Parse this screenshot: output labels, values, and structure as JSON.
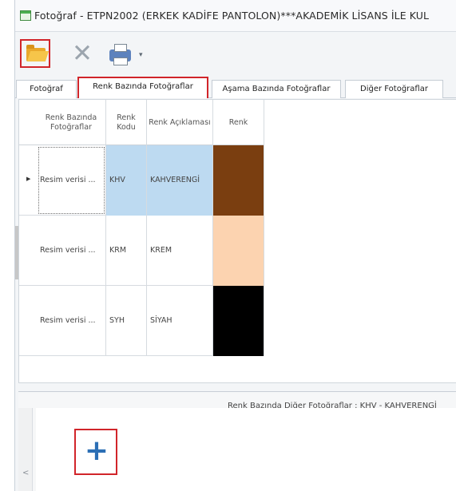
{
  "window": {
    "title": "Fotoğraf - ETPN2002 (ERKEK KADİFE PANTOLON)***AKADEMİK LİSANS İLE KUL"
  },
  "toolbar": {
    "open_icon": "folder-open-icon",
    "delete_icon": "delete-x-icon",
    "print_icon": "printer-icon",
    "print_dropdown_icon": "chevron-down-icon"
  },
  "tabs": [
    {
      "label": "Fotoğraf",
      "active": false
    },
    {
      "label": "Renk Bazında Fotoğraflar",
      "active": true
    },
    {
      "label": "Aşama Bazında Fotoğraflar",
      "active": false
    },
    {
      "label": "Diğer Fotoğraflar",
      "active": false
    }
  ],
  "grid": {
    "columns": [
      "Renk Bazında Fotoğraflar",
      "Renk Kodu",
      "Renk Açıklaması",
      "Renk"
    ],
    "rows": [
      {
        "photo": "Resim verisi ...",
        "code": "KHV",
        "description": "KAHVERENGİ",
        "color": "#7a3e10",
        "selected": true
      },
      {
        "photo": "Resim verisi ...",
        "code": "KRM",
        "description": "KREM",
        "color": "#fcd3b0",
        "selected": false
      },
      {
        "photo": "Resim verisi ...",
        "code": "SYH",
        "description": "SİYAH",
        "color": "#000000",
        "selected": false
      }
    ]
  },
  "bottom_panel": {
    "caption": "Renk Bazında Diğer Fotoğraflar : KHV - KAHVERENGİ",
    "add_symbol": "+",
    "scroll_left_symbol": "<"
  },
  "colors": {
    "highlight_red": "#d1252a",
    "selection_blue": "#bddaf1",
    "plus_blue": "#2c6fb5"
  }
}
